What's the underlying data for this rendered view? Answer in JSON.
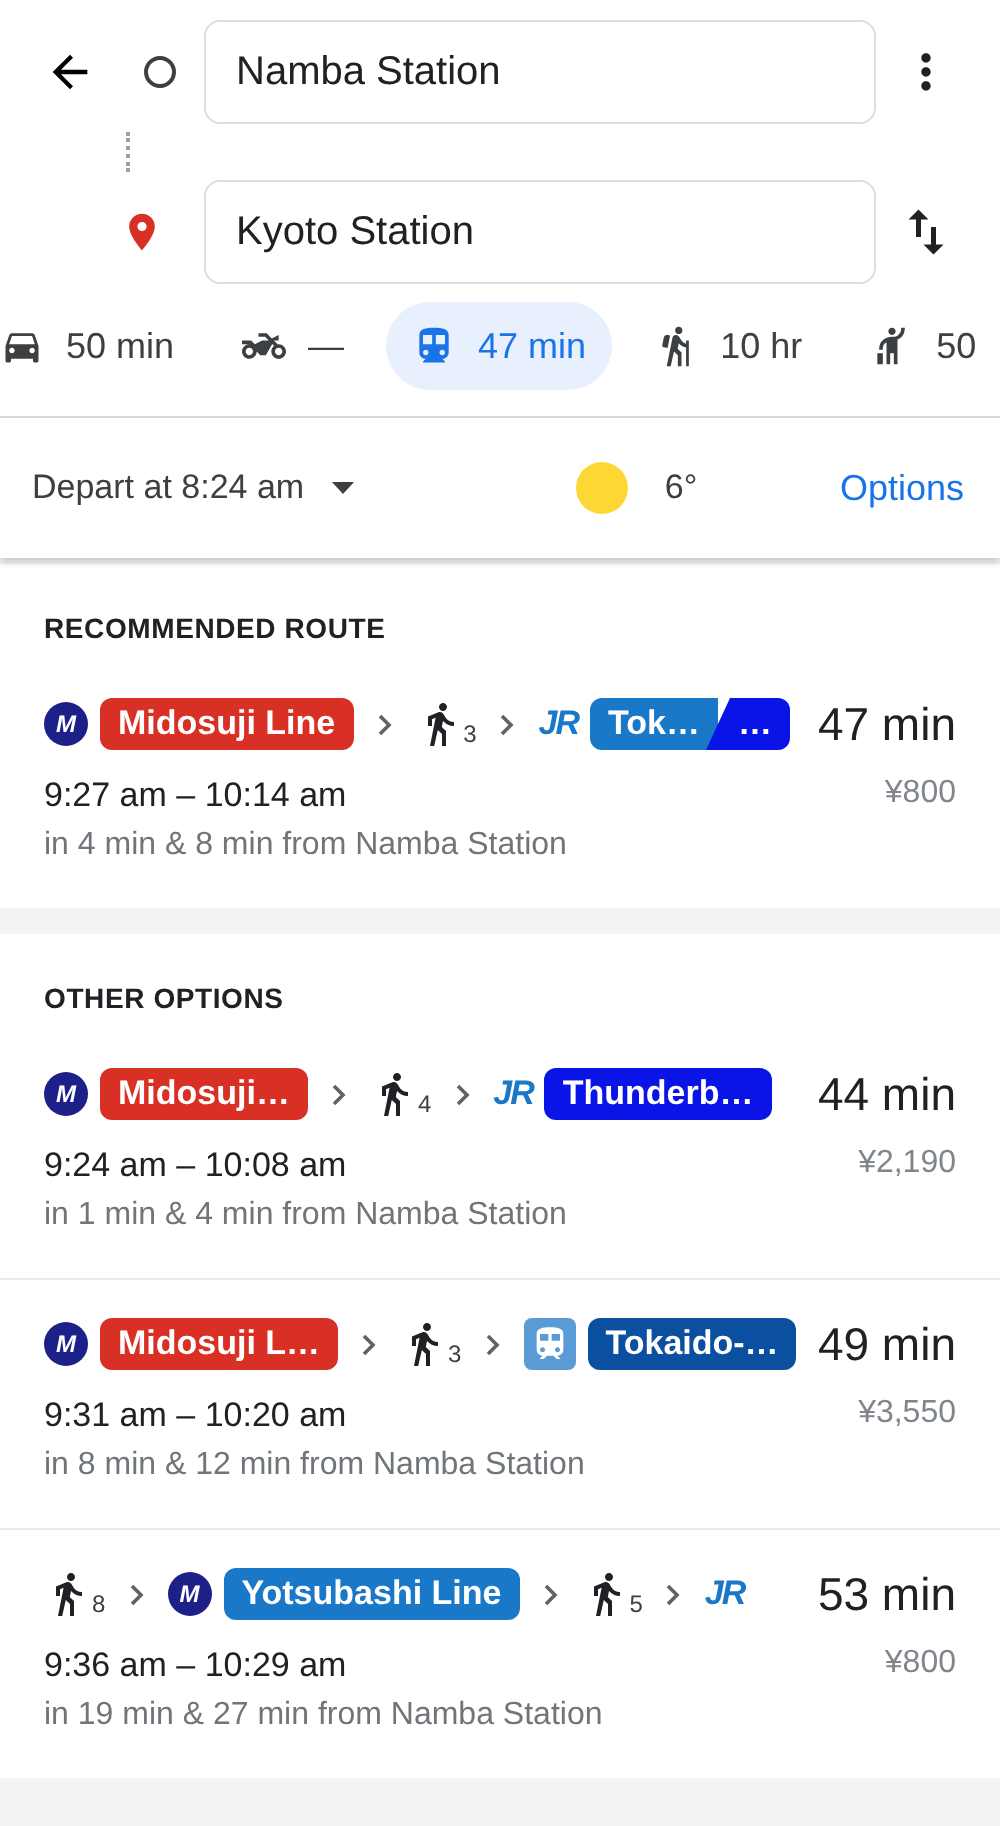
{
  "search": {
    "origin": "Namba Station",
    "destination": "Kyoto Station"
  },
  "modes": [
    {
      "kind": "car",
      "label": "50 min",
      "selected": false
    },
    {
      "kind": "motorcycle",
      "label": "—",
      "selected": false
    },
    {
      "kind": "transit",
      "label": "47 min",
      "selected": true
    },
    {
      "kind": "walk",
      "label": "10 hr",
      "selected": false
    },
    {
      "kind": "ride",
      "label": "50",
      "selected": false
    }
  ],
  "depart": {
    "label": "Depart at 8:24 am",
    "temperature": "6°",
    "options": "Options"
  },
  "sections": [
    {
      "title": "RECOMMENDED ROUTE",
      "routes": [
        {
          "steps": [
            {
              "kind": "metro",
              "logo": "M",
              "segments": [
                {
                  "text": "Midosuji Line",
                  "color": "#d93025"
                }
              ]
            },
            {
              "kind": "walk",
              "count": "3"
            },
            {
              "kind": "jr",
              "logo": "JR",
              "segments": [
                {
                  "text": "Tok…",
                  "color": "#1a78c9"
                },
                {
                  "text": "…",
                  "color": "#0a14e6"
                }
              ]
            }
          ],
          "duration": "47 min",
          "times": "9:27 am – 10:14 am",
          "fare": "¥800",
          "detail": "in 4 min & 8 min from Namba Station"
        }
      ]
    },
    {
      "title": "OTHER OPTIONS",
      "routes": [
        {
          "steps": [
            {
              "kind": "metro",
              "logo": "M",
              "segments": [
                {
                  "text": "Midosuji…",
                  "color": "#d93025"
                }
              ]
            },
            {
              "kind": "walk",
              "count": "4"
            },
            {
              "kind": "jr",
              "logo": "JR",
              "segments": [
                {
                  "text": "Thunderb…",
                  "color": "#0a14e6"
                }
              ]
            }
          ],
          "duration": "44 min",
          "times": "9:24 am – 10:08 am",
          "fare": "¥2,190",
          "detail": "in 1 min & 4 min from Namba Station"
        },
        {
          "steps": [
            {
              "kind": "metro",
              "logo": "M",
              "segments": [
                {
                  "text": "Midosuji L…",
                  "color": "#d93025"
                }
              ]
            },
            {
              "kind": "walk",
              "count": "3"
            },
            {
              "kind": "shinkansen",
              "segments": [
                {
                  "text": "Tokaido-…",
                  "color": "#0b4fa0"
                }
              ]
            }
          ],
          "duration": "49 min",
          "times": "9:31 am – 10:20 am",
          "fare": "¥3,550",
          "detail": "in 8 min & 12 min from Namba Station"
        },
        {
          "steps": [
            {
              "kind": "walk",
              "count": "8"
            },
            {
              "kind": "metro",
              "logo": "M",
              "segments": [
                {
                  "text": "Yotsubashi Line",
                  "color": "#1a78c9"
                }
              ]
            },
            {
              "kind": "walk",
              "count": "5"
            },
            {
              "kind": "jr",
              "logo": "JR"
            }
          ],
          "duration": "53 min",
          "times": "9:36 am – 10:29 am",
          "fare": "¥800",
          "detail": "in 19 min & 27 min from Namba Station"
        }
      ]
    }
  ]
}
